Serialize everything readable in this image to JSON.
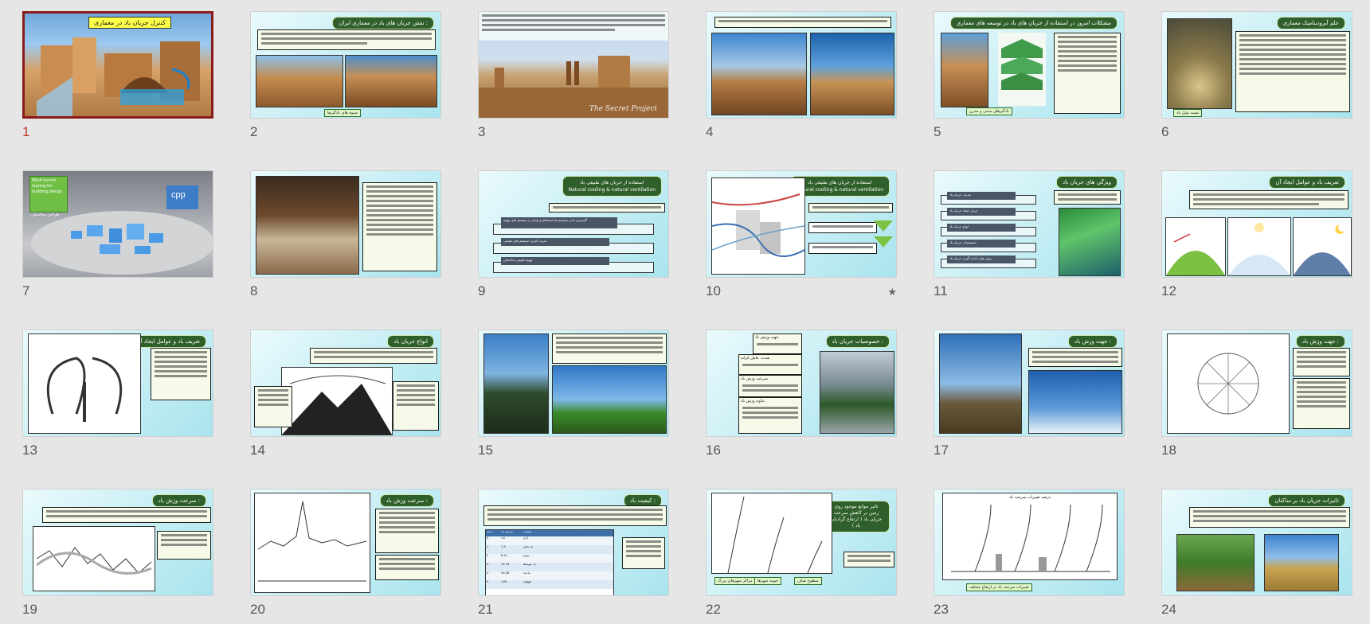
{
  "app": {
    "view": "slide-sorter"
  },
  "slides": [
    {
      "n": "1",
      "title": "کنترل جریان باد در معماری",
      "active": true
    },
    {
      "n": "2",
      "title": "نقش جریان های باد در معماری ایران :",
      "caption": "شیوه های بادگیرها"
    },
    {
      "n": "3",
      "overlay": "The Secret Project"
    },
    {
      "n": "4",
      "title": ""
    },
    {
      "n": "5",
      "title": "مشکلات امروز در استفاده از جریان های باد در توسعه های معماری",
      "caption": "بادگیرهای سنتی و مدرن"
    },
    {
      "n": "6",
      "title": "علم آیرودینامیک معماری",
      "caption": "تست تونل باد"
    },
    {
      "n": "7",
      "sign": [
        "Wind tunnel",
        "testing for",
        "building design"
      ],
      "sign_sub": "طراحی ساختمان",
      "badge": "cpp"
    },
    {
      "n": "8",
      "title": ""
    },
    {
      "n": "9",
      "title": "استفاده از جریان های طبیعی باد",
      "subtitle": "Natural cooling & natural ventilation",
      "rows": [
        "گسترش دادن سیستم ها مستحکم و پایدار در سیستم های تهویه",
        "مزیت کاربرد سیستم های طبیعی",
        "تهویه طبیعی ساختمان"
      ]
    },
    {
      "n": "10",
      "title": "استفاده از جریان های طبیعی باد",
      "subtitle": "Natural cooling & natural ventilation",
      "has_animation": true
    },
    {
      "n": "11",
      "title": "ویژگی های جریان باد",
      "rows": [
        "تعریف جریان باد",
        "جریان ایجاد جریان باد",
        "انواع جریان باد",
        "خصوصیات جریان باد",
        "روش های اندازه گیری جریان باد"
      ]
    },
    {
      "n": "12",
      "title": "تعریف باد و عوامل ایجاد آن"
    },
    {
      "n": "13",
      "title": "تعریف باد و عوامل ایجاد آن"
    },
    {
      "n": "14",
      "title": "انواع جریان باد"
    },
    {
      "n": "15",
      "title": ""
    },
    {
      "n": "16",
      "title": "خصوصیات جریان باد :",
      "rows": [
        "جهت وزش باد",
        "شدت عامل کرانه",
        "سرعت وزش باد",
        "تداوم وزش باد"
      ]
    },
    {
      "n": "17",
      "title": "جهت وزش باد :"
    },
    {
      "n": "18",
      "title": "جهت وزش باد :"
    },
    {
      "n": "19",
      "title": "سرعت وزش باد :"
    },
    {
      "n": "20",
      "title": "سرعت وزش باد :"
    },
    {
      "n": "21",
      "title": "کیفیت باد :",
      "table_header": [
        "درجه",
        "سرعت باد",
        "توصیف"
      ],
      "table_rows": [
        [
          "0",
          "<1",
          "آرام"
        ],
        [
          "1",
          "1-5",
          "باد ملایم"
        ],
        [
          "2",
          "6-11",
          "نسیم"
        ],
        [
          "3",
          "12-19",
          "باد متوسط"
        ],
        [
          "4",
          "20-28",
          "باد تند"
        ],
        [
          "5",
          ">29",
          "طوفان"
        ]
      ]
    },
    {
      "n": "22",
      "title": "تاثیر موانع موجود روی زمین بر کاهش سرعت جریان باد ( ارتفاع گرادیان باد )",
      "labels": [
        "مراکز شهرهای بزرگ",
        "حومه شهرها",
        "سطوح صاف"
      ]
    },
    {
      "n": "23",
      "title": "درصد تغییرات سرعت باد",
      "caption": "تغییرات سرعت باد در ارتفاع مختلف"
    },
    {
      "n": "24",
      "title": "تاثیرات جریان باد بر ساکنان"
    }
  ]
}
